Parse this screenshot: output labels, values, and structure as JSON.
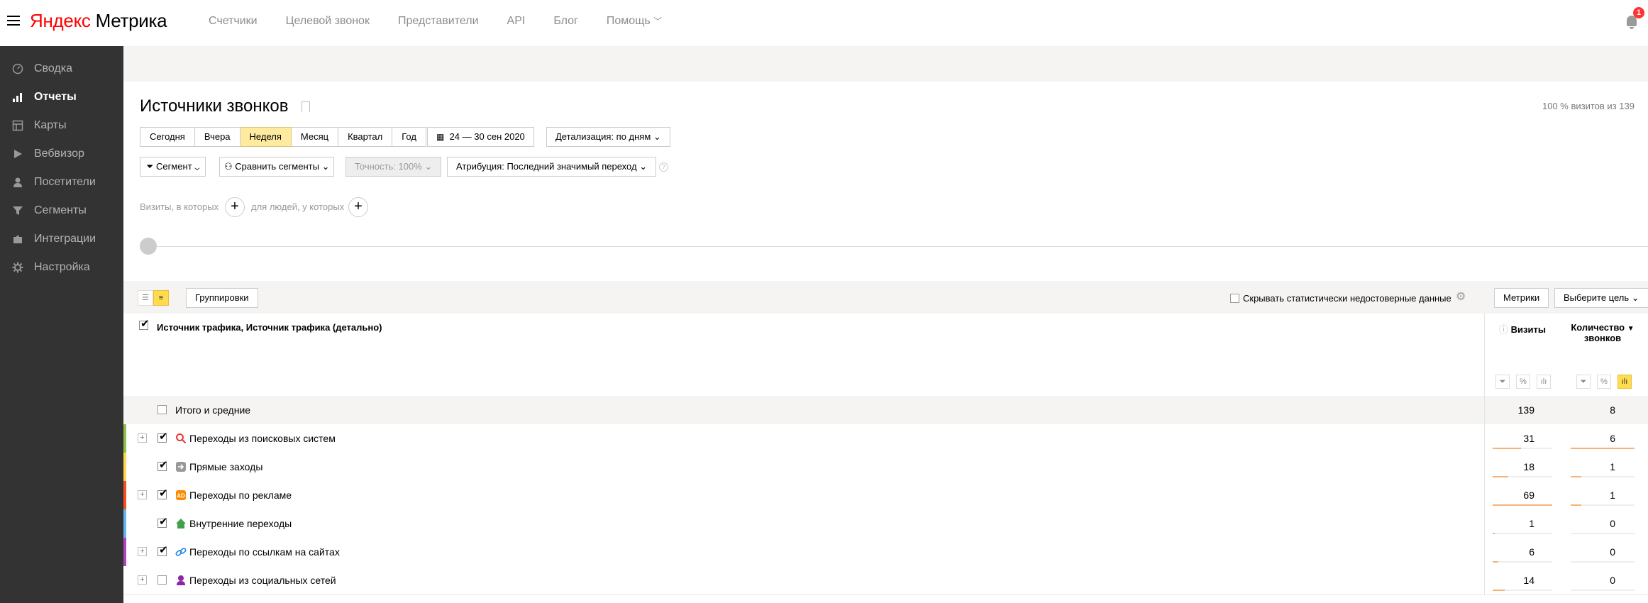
{
  "header": {
    "logo_part1": "Яндекс",
    "logo_part2": " Метрика",
    "nav": [
      "Счетчики",
      "Целевой звонок",
      "Представители",
      "API",
      "Блог",
      "Помощь"
    ],
    "notifications": "1"
  },
  "sidebar": {
    "items": [
      {
        "label": "Сводка",
        "icon": "gauge-icon"
      },
      {
        "label": "Отчеты",
        "icon": "bar-chart-icon"
      },
      {
        "label": "Карты",
        "icon": "map-icon"
      },
      {
        "label": "Вебвизор",
        "icon": "play-icon"
      },
      {
        "label": "Посетители",
        "icon": "user-icon"
      },
      {
        "label": "Сегменты",
        "icon": "funnel-icon"
      },
      {
        "label": "Интеграции",
        "icon": "puzzle-icon"
      },
      {
        "label": "Настройка",
        "icon": "gear-icon"
      }
    ],
    "active": "Отчеты"
  },
  "report": {
    "title": "Источники звонков",
    "visits_info": "100 % визитов из 139",
    "periods": [
      "Сегодня",
      "Вчера",
      "Неделя",
      "Месяц",
      "Квартал",
      "Год"
    ],
    "active_period": "Неделя",
    "date_range": "24 — 30 сен 2020",
    "detail": "Детализация: по дням",
    "segment": "Сегмент",
    "compare": "Сравнить сегменты",
    "accuracy": "Точность: 100%",
    "attribution": "Атрибуция: Последний значимый переход",
    "visits_where": "Визиты, в которых",
    "people_where": "для людей, у которых"
  },
  "toolbar": {
    "groupings": "Группировки",
    "hide_unreliable": "Скрывать статистически недостоверные данные",
    "metrics": "Метрики",
    "choose_goal": "Выберите цель"
  },
  "table": {
    "dimension_header": "Источник трафика, Источник трафика (детально)",
    "col_visits": "Визиты",
    "col_calls_1": "Количество",
    "col_calls_2": "звонков",
    "totals": {
      "label": "Итого и средние",
      "visits": "139",
      "calls": "8"
    },
    "rows": [
      {
        "label": "Переходы из поисковых систем",
        "visits": "31",
        "calls": "6",
        "color": "#8bc34a",
        "icon": "search-icon",
        "checked": true,
        "expandable": true
      },
      {
        "label": "Прямые заходы",
        "visits": "18",
        "calls": "1",
        "color": "#ffd54f",
        "icon": "direct-entry-icon",
        "checked": true,
        "expandable": false
      },
      {
        "label": "Переходы по рекламе",
        "visits": "69",
        "calls": "1",
        "color": "#f4511e",
        "icon": "ad-icon",
        "checked": true,
        "expandable": true
      },
      {
        "label": "Внутренние переходы",
        "visits": "1",
        "calls": "0",
        "color": "#64b5f6",
        "icon": "home-icon",
        "checked": true,
        "expandable": false
      },
      {
        "label": "Переходы по ссылкам на сайтах",
        "visits": "6",
        "calls": "0",
        "color": "#ab47bc",
        "icon": "link-icon",
        "checked": true,
        "expandable": true
      },
      {
        "label": "Переходы из социальных сетей",
        "visits": "14",
        "calls": "0",
        "color": "#ffffff",
        "icon": "social-icon",
        "checked": false,
        "expandable": true
      }
    ]
  }
}
